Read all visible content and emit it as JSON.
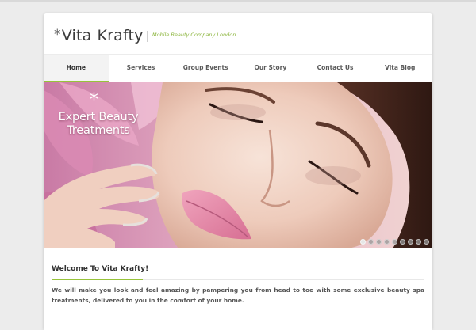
{
  "brand": {
    "logo_asterisk": "*",
    "logo_word1": "Vita",
    "logo_word2": "Krafty",
    "tagline": "Mobile Beauty Company London"
  },
  "nav": {
    "items": [
      {
        "label": "Home",
        "active": true
      },
      {
        "label": "Services",
        "active": false
      },
      {
        "label": "Group Events",
        "active": false
      },
      {
        "label": "Our Story",
        "active": false
      },
      {
        "label": "Contact Us",
        "active": false
      },
      {
        "label": "Vita Blog",
        "active": false
      }
    ]
  },
  "hero": {
    "star": "*",
    "title_line1": "Expert Beauty",
    "title_line2": "Treatments",
    "slide_count": 9,
    "active_slide": 1
  },
  "welcome": {
    "title": "Welcome To Vita Krafty!",
    "intro": "We will make you look and feel amazing by pampering you from head to toe with some exclusive beauty spa treatments, delivered to you in the comfort of your home."
  },
  "colors": {
    "accent": "#97c33a",
    "tagline": "#8ab43a",
    "background": "#ececec"
  }
}
